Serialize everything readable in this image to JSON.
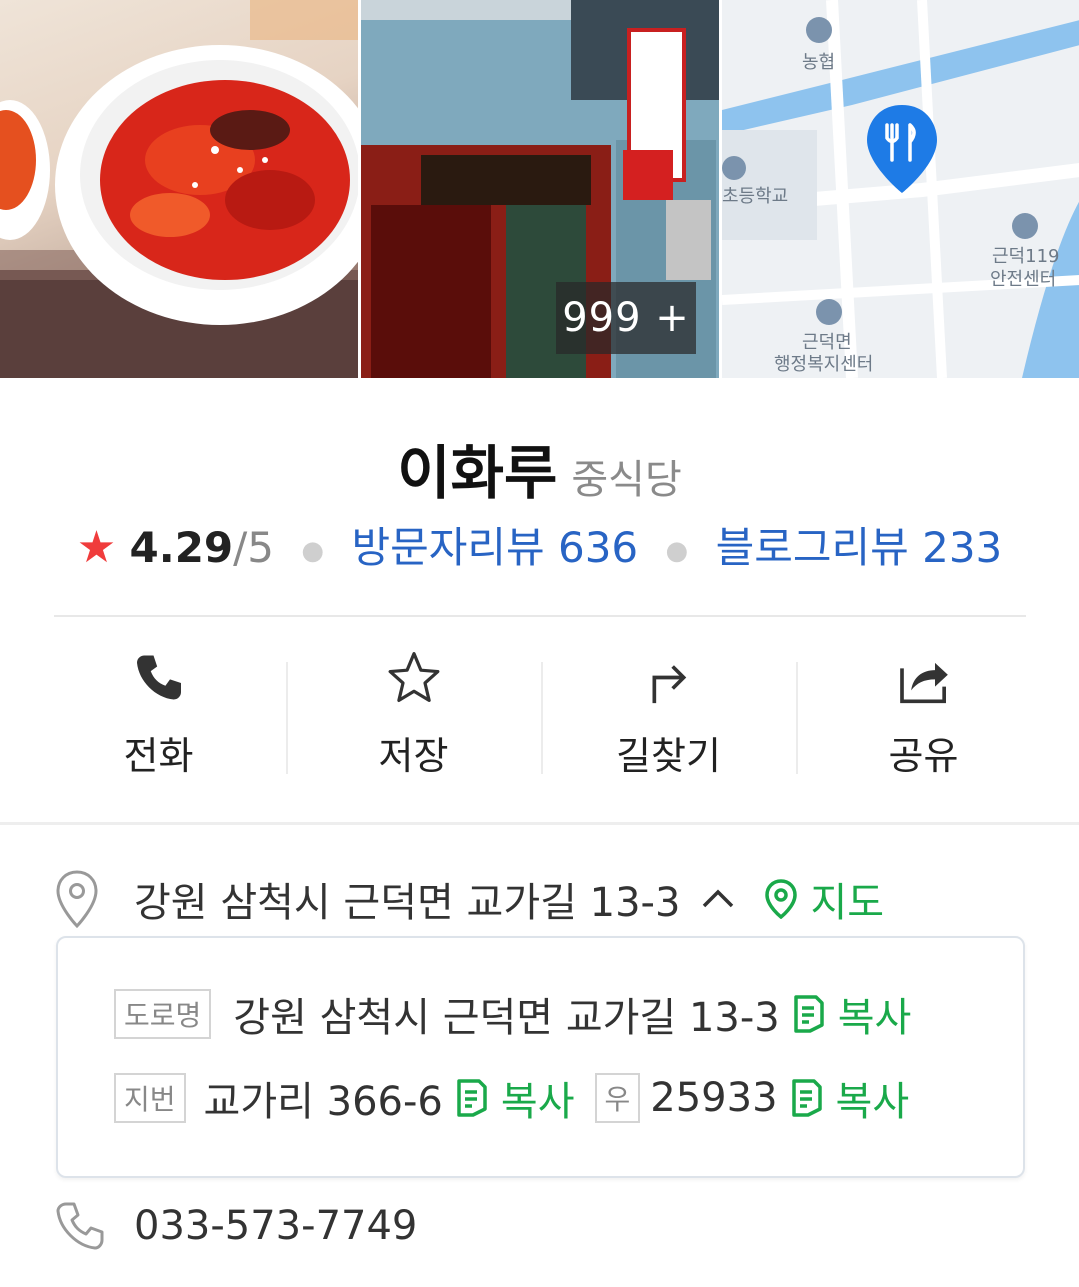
{
  "photos": {
    "more_count": "999 +"
  },
  "map_thumb": {
    "labels": [
      "농협",
      "초등학교",
      "근덕119",
      "안전센터",
      "근덕면",
      "행정복지센터"
    ]
  },
  "place": {
    "name": "이화루",
    "category": "중식당",
    "score": "4.29",
    "out_of": "/5",
    "visitor_reviews": "방문자리뷰 636",
    "blog_reviews": "블로그리뷰 233",
    "star_color": "#f03c3c",
    "link_color": "#2864c4"
  },
  "actions": [
    {
      "label": "전화",
      "icon": "phone-icon"
    },
    {
      "label": "저장",
      "icon": "star-outline-icon"
    },
    {
      "label": "길찾기",
      "icon": "directions-icon"
    },
    {
      "label": "공유",
      "icon": "share-icon"
    }
  ],
  "address": {
    "main": "강원 삼척시 근덕면 교가길 13-3",
    "map_label": "지도",
    "road_tag": "도로명",
    "road_value": "강원 삼척시 근덕면 교가길 13-3",
    "lot_tag": "지번",
    "lot_value": "교가리 366-6",
    "zip_tag": "우",
    "zip_value": "25933",
    "copy_label": "복사",
    "accent_color": "#1aa94a"
  },
  "phone": {
    "number": "033-573-7749"
  }
}
